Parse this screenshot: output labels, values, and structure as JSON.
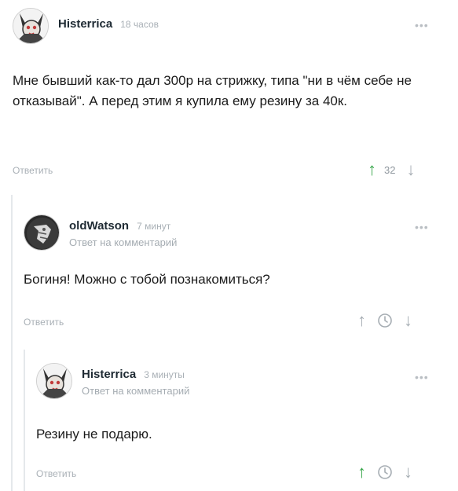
{
  "comments": [
    {
      "author": "Histerrica",
      "time": "18 часов",
      "reply_to": "",
      "text": "Мне бывший как-то дал 300р на стрижку, типа \"ни в чём себе не отказывай\". А перед этим я купила ему резину за 40к.",
      "reply_label": "Ответить",
      "score": "32",
      "vote": "up",
      "more": "•••"
    },
    {
      "author": "oldWatson",
      "time": "7 минут",
      "reply_to": "Ответ на комментарий",
      "text": "Богиня! Можно с тобой познакомиться?",
      "reply_label": "Ответить",
      "score": "",
      "vote": "none",
      "more": "•••"
    },
    {
      "author": "Histerrica",
      "time": "3 минуты",
      "reply_to": "Ответ на комментарий",
      "text": "Резину не подарю.",
      "reply_label": "Ответить",
      "score": "",
      "vote": "up",
      "more": "•••"
    }
  ],
  "icons": {
    "upvote": "↑",
    "downvote": "↓",
    "save": "clock-icon"
  },
  "colors": {
    "upvote_active": "#37a64a",
    "muted": "#a9b0b6",
    "thread_line": "#e5e8eb"
  }
}
